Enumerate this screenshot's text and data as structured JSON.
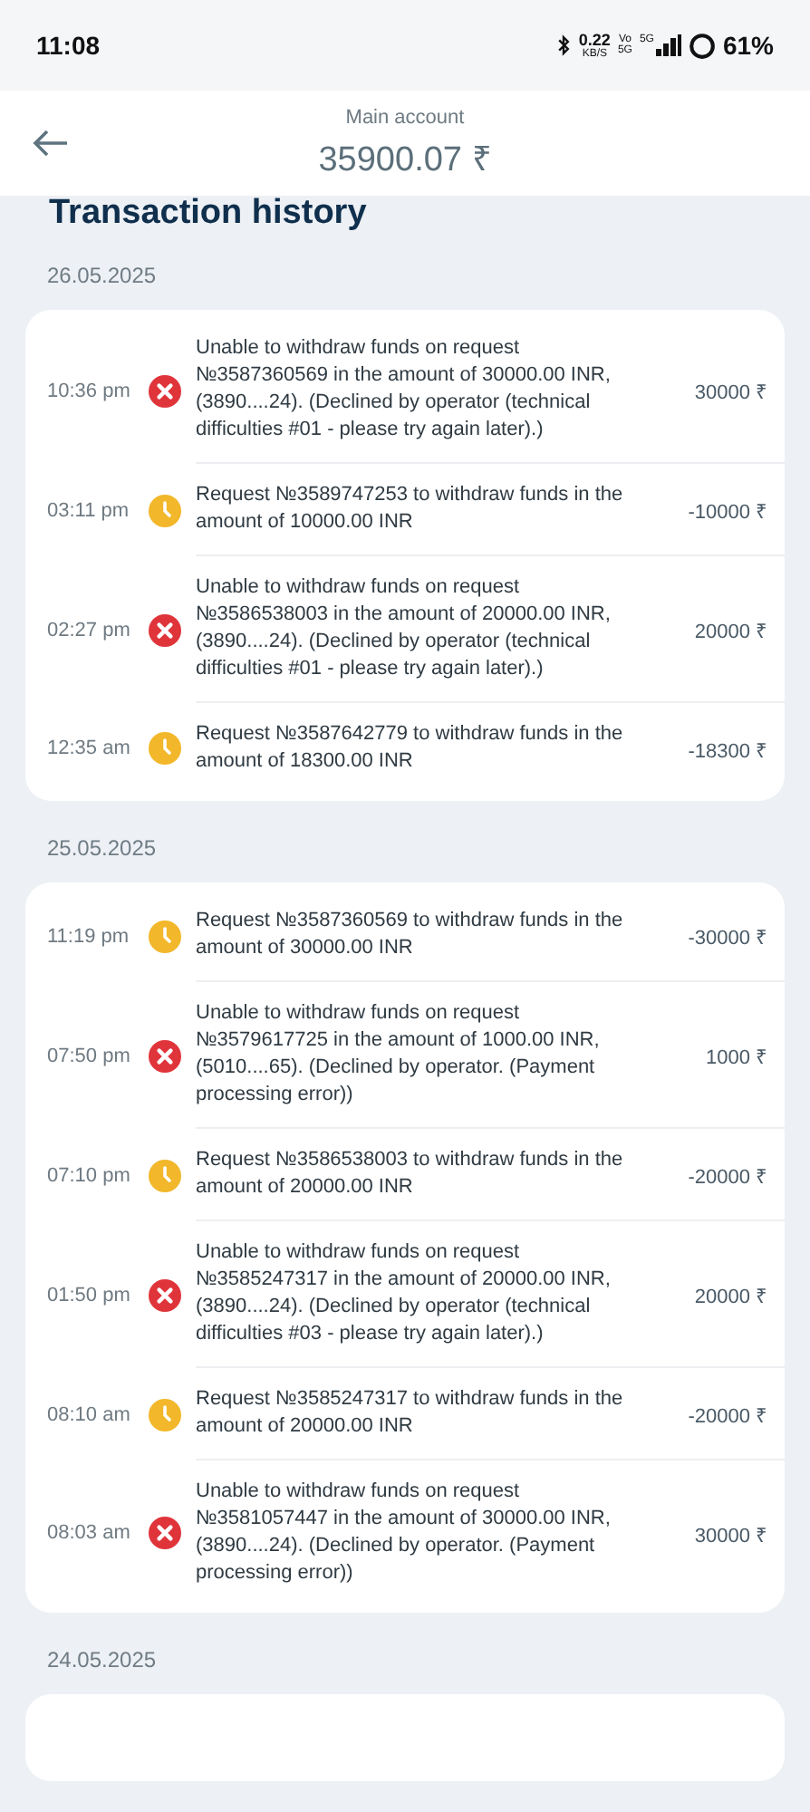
{
  "status_bar": {
    "time": "11:08",
    "speed": "0.22",
    "speed_unit": "KB/S",
    "volte_top": "Vo",
    "volte_bottom": "5G",
    "network": "5G",
    "battery": "61%"
  },
  "header": {
    "subtitle": "Main account",
    "balance": "35900.07 ₹"
  },
  "title": "Transaction history",
  "groups": [
    {
      "date": "26.05.2025",
      "transactions": [
        {
          "time": "10:36 pm",
          "kind": "declined",
          "text": "Unable to withdraw funds on request №3587360569 in the amount of 30000.00 INR, (3890....24). (Declined by operator (technical difficulties #01 - please try again later).)",
          "amount": "30000 ₹"
        },
        {
          "time": "03:11 pm",
          "kind": "pending",
          "text": "Request №3589747253 to withdraw funds in the amount of 10000.00 INR",
          "amount": "-10000 ₹"
        },
        {
          "time": "02:27 pm",
          "kind": "declined",
          "text": "Unable to withdraw funds on request №3586538003 in the amount of 20000.00 INR, (3890....24). (Declined by operator (technical difficulties #01 - please try again later).)",
          "amount": "20000 ₹"
        },
        {
          "time": "12:35 am",
          "kind": "pending",
          "text": "Request №3587642779 to withdraw funds in the amount of 18300.00 INR",
          "amount": "-18300 ₹"
        }
      ]
    },
    {
      "date": "25.05.2025",
      "transactions": [
        {
          "time": "11:19 pm",
          "kind": "pending",
          "text": "Request №3587360569 to withdraw funds in the amount of 30000.00 INR",
          "amount": "-30000 ₹"
        },
        {
          "time": "07:50 pm",
          "kind": "declined",
          "text": "Unable to withdraw funds on request №3579617725 in the amount of 1000.00 INR, (5010....65). (Declined by operator. (Payment processing error))",
          "amount": "1000 ₹"
        },
        {
          "time": "07:10 pm",
          "kind": "pending",
          "text": "Request №3586538003 to withdraw funds in the amount of 20000.00 INR",
          "amount": "-20000 ₹"
        },
        {
          "time": "01:50 pm",
          "kind": "declined",
          "text": "Unable to withdraw funds on request №3585247317 in the amount of 20000.00 INR, (3890....24). (Declined by operator (technical difficulties #03 - please try again later).)",
          "amount": "20000 ₹"
        },
        {
          "time": "08:10 am",
          "kind": "pending",
          "text": "Request №3585247317 to withdraw funds in the amount of 20000.00 INR",
          "amount": "-20000 ₹"
        },
        {
          "time": "08:03 am",
          "kind": "declined",
          "text": "Unable to withdraw funds on request №3581057447 in the amount of 30000.00 INR, (3890....24). (Declined by operator. (Payment processing error))",
          "amount": "30000 ₹"
        }
      ]
    },
    {
      "date": "24.05.2025"
    }
  ]
}
